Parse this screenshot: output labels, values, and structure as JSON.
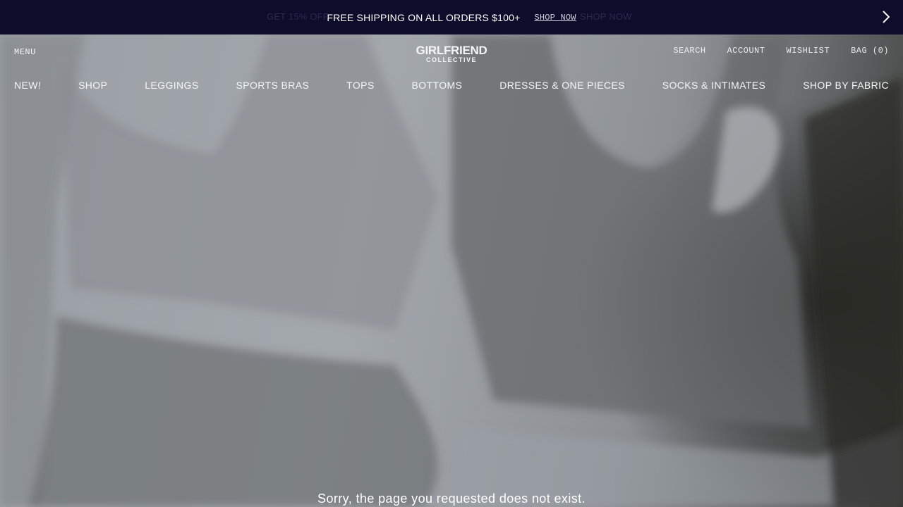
{
  "announcement": {
    "message": "FREE SHIPPING ON ALL ORDERS $100+",
    "link": "SHOP NOW",
    "ghost_left": "GET 15% OFF",
    "ghost_right": "SHOP NOW"
  },
  "header": {
    "menu_label": "MENU",
    "logo_line1": "GIRLFRIEND",
    "logo_line2": "COLLECTIVE",
    "utilities": [
      "SEARCH",
      "ACCOUNT",
      "WISHLIST",
      "BAG (0)"
    ]
  },
  "nav": {
    "items": [
      "NEW!",
      "SHOP",
      "LEGGINGS",
      "SPORTS BRAS",
      "TOPS",
      "BOTTOMS",
      "DRESSES & ONE PIECES",
      "SOCKS & INTIMATES",
      "SHOP BY FABRIC"
    ]
  },
  "main": {
    "error_message": "Sorry, the page you requested does not exist."
  },
  "icons": {
    "next": "chevron-right-icon"
  },
  "colors": {
    "announcement_bg": "#0d0c2b",
    "text_light": "#ffffff"
  }
}
